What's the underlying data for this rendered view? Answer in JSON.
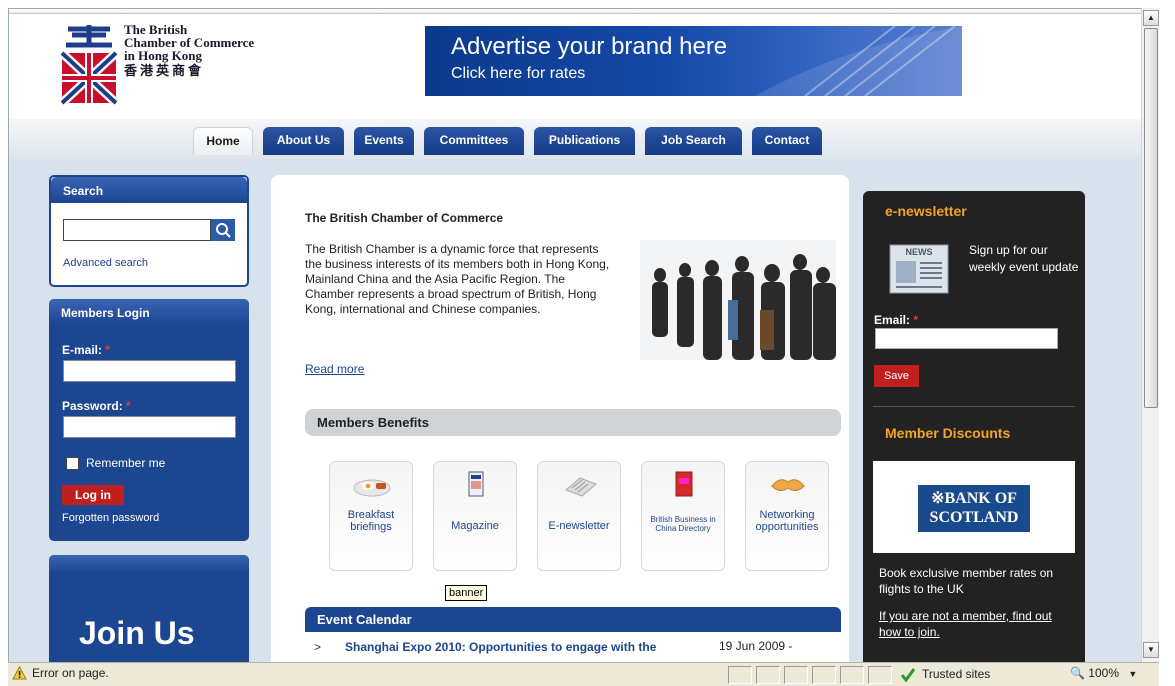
{
  "logo": {
    "line1": "The British",
    "line2": "Chamber of Commerce",
    "line3": "in Hong Kong",
    "chinese": "香港英商會"
  },
  "banner": {
    "line1": "Advertise your brand here",
    "line2": "Click here for rates"
  },
  "nav": {
    "tabs": [
      "Home",
      "About Us",
      "Events",
      "Committees",
      "Publications",
      "Job Search",
      "Contact"
    ],
    "active": "Home"
  },
  "search": {
    "title": "Search",
    "advanced": "Advanced search"
  },
  "login": {
    "title": "Members Login",
    "email_label": "E-mail:",
    "password_label": "Password:",
    "required_mark": "*",
    "remember": "Remember me",
    "button": "Log in",
    "forgot": "Forgotten password"
  },
  "join": {
    "title": "Join Us"
  },
  "main": {
    "title": "The British Chamber of Commerce",
    "paragraph": "The British Chamber is a dynamic force that represents the business interests of its members both in Hong Kong, Mainland China and the Asia Pacific Region. The Chamber represents a broad spectrum of British, Hong Kong, international and Chinese companies.",
    "read_more": "Read more",
    "benefits_title": "Members Benefits",
    "benefits": [
      {
        "label": "Breakfast briefings",
        "icon": "breakfast-icon"
      },
      {
        "label": "Magazine",
        "icon": "magazine-icon"
      },
      {
        "label": "E-newsletter",
        "icon": "newsletter-icon"
      },
      {
        "label": "British Business in China Directory",
        "icon": "directory-icon"
      },
      {
        "label": "Networking opportunities",
        "icon": "handshake-icon"
      }
    ],
    "tooltip": "banner",
    "event_title": "Event Calendar",
    "event": {
      "bullet": ">",
      "title": "Shanghai Expo 2010: Opportunities to engage with the",
      "date": "19 Jun 2009 -"
    }
  },
  "right": {
    "newsletter_title": "e-newsletter",
    "news_img_label": "NEWS",
    "newsletter_text": "Sign up for our weekly event update",
    "email_label": "Email:",
    "required_mark": "*",
    "save": "Save",
    "discounts_title": "Member Discounts",
    "bank_line1": "※BANK OF",
    "bank_line2": "SCOTLAND",
    "offer": "Book exclusive member rates on flights to the UK",
    "join_link": "If you are not a member, find out how to join."
  },
  "statusbar": {
    "message": "Error on page.",
    "zone": "Trusted sites",
    "zoom": "100%"
  },
  "colors": {
    "navy": "#1d4691",
    "orange": "#f4a423",
    "red": "#c01f1f",
    "dark": "#222222"
  }
}
